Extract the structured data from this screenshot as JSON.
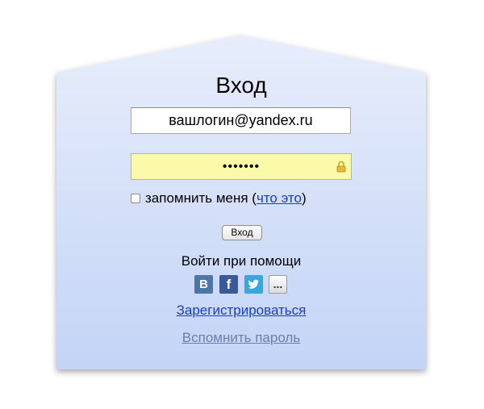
{
  "form": {
    "title": "Вход",
    "login_value": "вашлогин@yandex.ru",
    "password_mask": "•••••••",
    "remember_label": "запомнить меня (",
    "remember_link": "что это",
    "remember_close": ")",
    "submit_label": "Вход"
  },
  "social": {
    "caption": "Войти при помощи",
    "vk_label": "B",
    "fb_label": "f",
    "more_label": "..."
  },
  "links": {
    "register": "Зарегистрироваться",
    "forgot": "Вспомнить пароль"
  },
  "colors": {
    "panel_top": "#e5ecfb",
    "panel_bottom": "#c4d5f6",
    "link": "#1a3dc1",
    "password_bg": "#fbfaa8"
  }
}
